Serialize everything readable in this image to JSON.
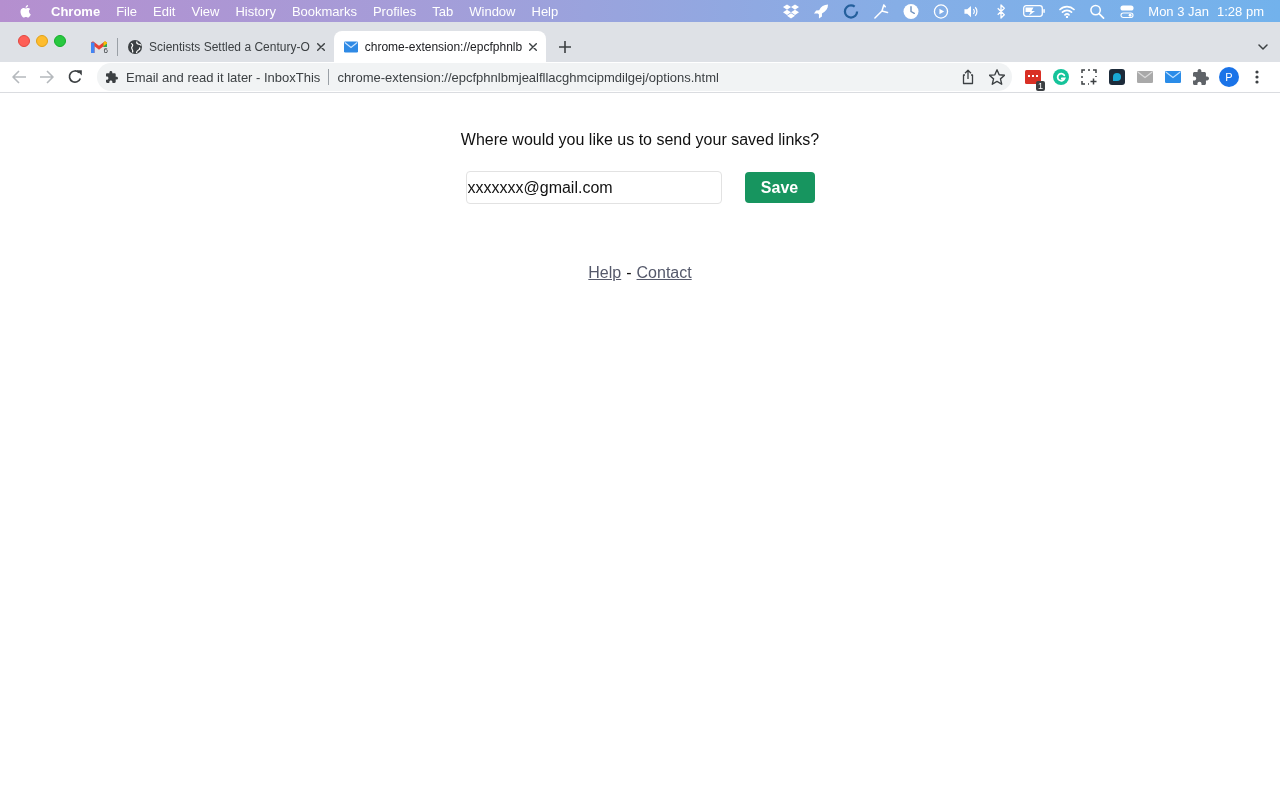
{
  "menu_bar": {
    "app_name": "Chrome",
    "menus": [
      "File",
      "Edit",
      "View",
      "History",
      "Bookmarks",
      "Profiles",
      "Tab",
      "Window",
      "Help"
    ],
    "date": "Mon 3 Jan",
    "time": "1:28 pm"
  },
  "tabs": [
    {
      "kind": "pinned",
      "badge": "6",
      "selected": false
    },
    {
      "kind": "web",
      "title": "Scientists Settled a Century-O",
      "selected": false
    },
    {
      "kind": "extension",
      "title": "chrome-extension://epcfphnlb",
      "selected": true
    }
  ],
  "nav_buttons": [
    {
      "kind": "back",
      "disabled": true
    },
    {
      "kind": "forward",
      "disabled": true
    },
    {
      "kind": "reload",
      "disabled": false
    }
  ],
  "address_bar": {
    "page_title": "Email and read it later - InboxThis",
    "url": "chrome-extension://epcfphnlbmjealfllacghmcipmdilgej/options.html"
  },
  "extensions": {
    "badge": "1",
    "profile_initial": "P"
  },
  "page": {
    "prompt": "Where would you like us to send your saved links?",
    "email_field": {
      "value": "xxxxxxx@gmail.com"
    },
    "save_button": "Save",
    "links": [
      "Help",
      "Contact"
    ],
    "link_separator": "-"
  }
}
